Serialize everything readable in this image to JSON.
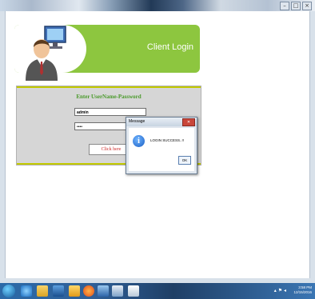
{
  "window": {
    "controls": [
      "–",
      "□",
      "×"
    ]
  },
  "banner": {
    "title": "Client Login"
  },
  "login": {
    "heading": "Enter UserName-Password",
    "username_value": "admin",
    "password_value": "••••",
    "button_label": "Click here"
  },
  "dialog": {
    "title": "Message",
    "close_label": "✕",
    "message": "LOGIN SUCCESS..!!",
    "ok_label": "OK"
  },
  "taskbar": {
    "time": "3:58 PM",
    "date": "12/15/2016",
    "tray_icons": "▴ ⚑ ◂"
  },
  "colors": {
    "banner_green": "#8dc63f",
    "heading_green": "#4a9a2b",
    "button_text_red": "#cc2a2a",
    "accent_line": "#c2c900"
  }
}
